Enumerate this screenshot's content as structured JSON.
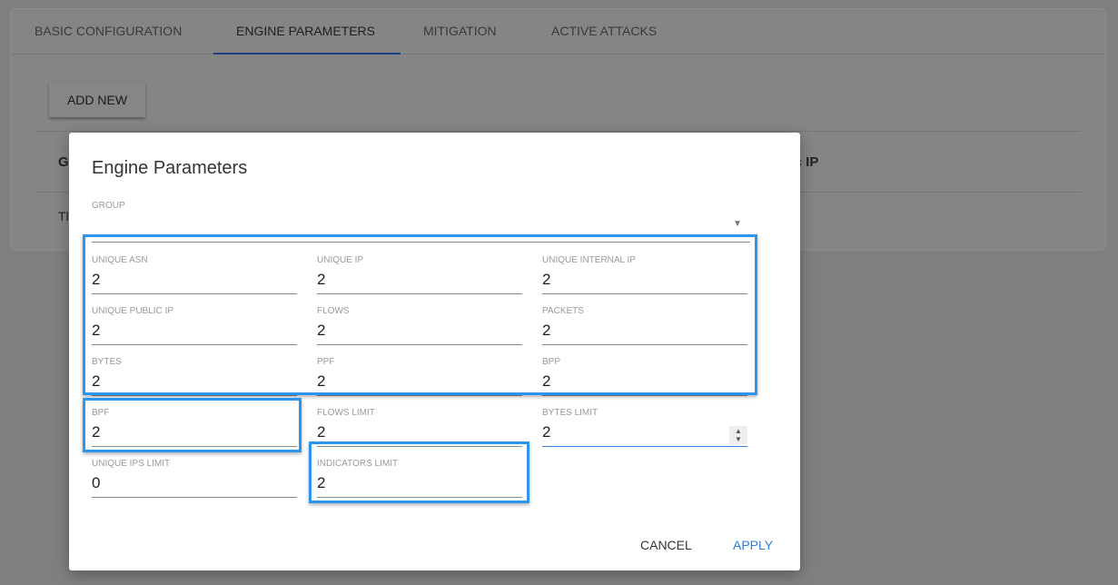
{
  "tabs": [
    {
      "label": "BASIC CONFIGURATION"
    },
    {
      "label": "ENGINE PARAMETERS"
    },
    {
      "label": "MITIGATION"
    },
    {
      "label": "ACTIVE ATTACKS"
    }
  ],
  "add_new_label": "ADD NEW",
  "background_table": {
    "header_first": "G",
    "header_last": "Public IP",
    "row_first": "Tl"
  },
  "dialog": {
    "title": "Engine Parameters",
    "group": {
      "label": "GROUP",
      "value": ""
    },
    "fields": [
      {
        "label": "UNIQUE ASN",
        "value": "2"
      },
      {
        "label": "UNIQUE IP",
        "value": "2"
      },
      {
        "label": "UNIQUE INTERNAL IP",
        "value": "2"
      },
      {
        "label": "UNIQUE PUBLIC IP",
        "value": "2"
      },
      {
        "label": "FLOWS",
        "value": "2"
      },
      {
        "label": "PACKETS",
        "value": "2"
      },
      {
        "label": "BYTES",
        "value": "2"
      },
      {
        "label": "PPF",
        "value": "2"
      },
      {
        "label": "BPP",
        "value": "2"
      },
      {
        "label": "BPF",
        "value": "2"
      },
      {
        "label": "FLOWS LIMIT",
        "value": "2"
      },
      {
        "label": "BYTES LIMIT",
        "value": "2"
      },
      {
        "label": "UNIQUE IPS LIMIT",
        "value": "0"
      },
      {
        "label": "INDICATORS LIMIT",
        "value": "2"
      }
    ],
    "cancel_label": "CANCEL",
    "apply_label": "APPLY"
  },
  "colors": {
    "accent": "#2f7de1",
    "highlight": "#2d95f0",
    "tab_indicator": "#1c3f80"
  }
}
